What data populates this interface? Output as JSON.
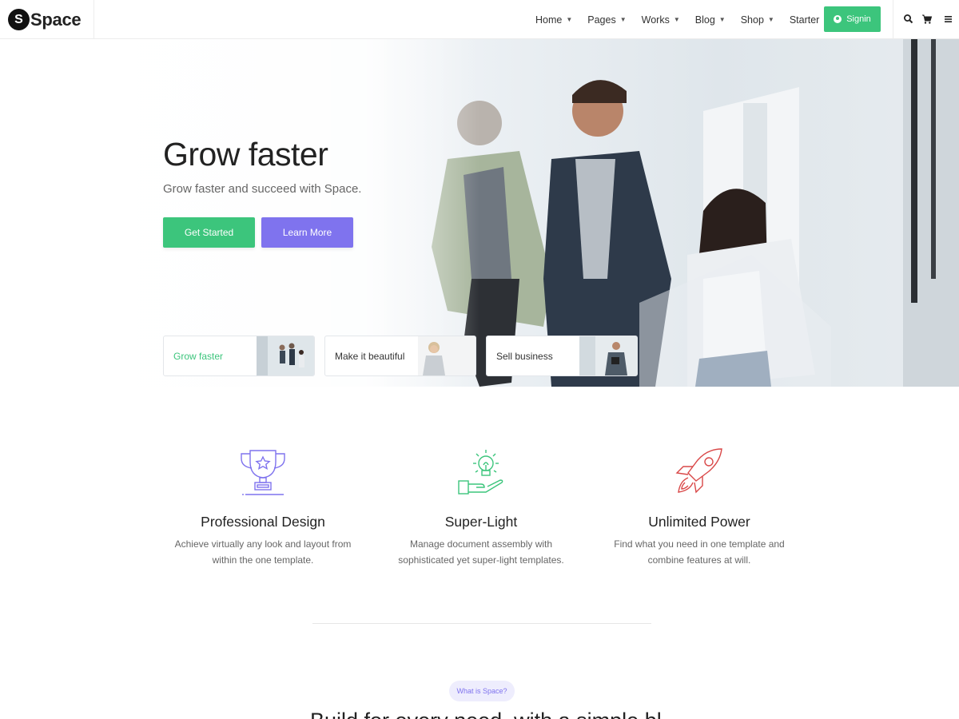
{
  "brand": {
    "mark": "S",
    "name": "Space"
  },
  "nav": [
    {
      "label": "Home",
      "has_dropdown": true
    },
    {
      "label": "Pages",
      "has_dropdown": true
    },
    {
      "label": "Works",
      "has_dropdown": true
    },
    {
      "label": "Blog",
      "has_dropdown": true
    },
    {
      "label": "Shop",
      "has_dropdown": true
    },
    {
      "label": "Starter",
      "has_dropdown": false
    }
  ],
  "header": {
    "signin_label": "Signin",
    "icons": [
      "search-icon",
      "cart-icon",
      "menu-icon"
    ]
  },
  "hero": {
    "title": "Grow faster",
    "subtitle": "Grow faster and succeed with Space.",
    "primary_button": "Get Started",
    "secondary_button": "Learn More",
    "cards": [
      {
        "label": "Grow faster",
        "active": true
      },
      {
        "label": "Make it beautiful",
        "active": false
      },
      {
        "label": "Sell business",
        "active": false
      }
    ]
  },
  "features": [
    {
      "icon": "trophy-icon",
      "title": "Professional Design",
      "line1": "Achieve virtually any look and layout from",
      "line2": "within the one template."
    },
    {
      "icon": "lightbulb-hand-icon",
      "title": "Super-Light",
      "line1": "Manage document assembly with",
      "line2": "sophisticated yet super-light templates."
    },
    {
      "icon": "rocket-icon",
      "title": "Unlimited Power",
      "line1": "Find what you need in one template and",
      "line2": "combine features at will."
    }
  ],
  "section": {
    "badge": "What is Space?",
    "heading": "Build for every need, with a simple bl"
  },
  "colors": {
    "green": "#3cc57c",
    "purple": "#7f73ee",
    "red": "#d94848",
    "dark": "#222222"
  }
}
